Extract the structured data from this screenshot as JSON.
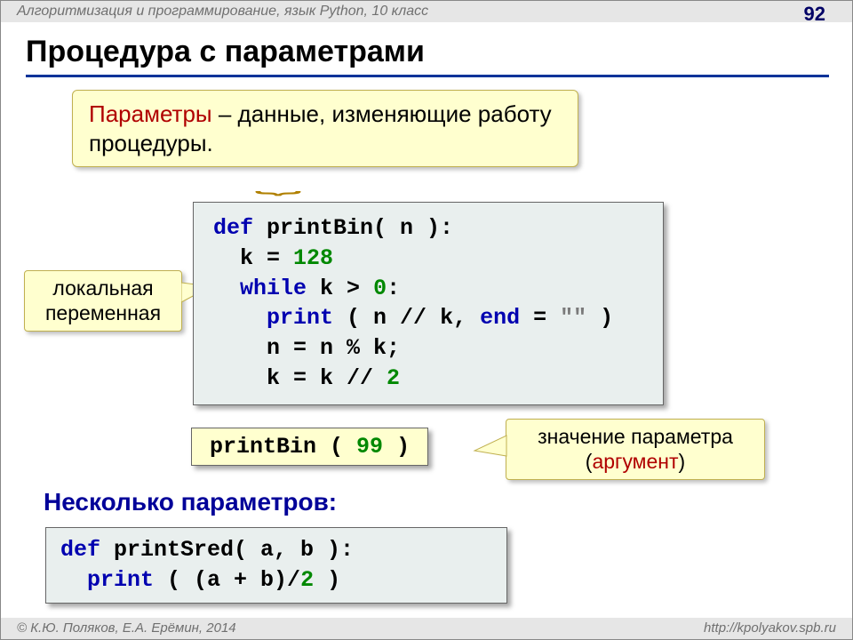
{
  "header": "Алгоритмизация и программирование, язык Python, 10 класс",
  "page": "92",
  "title": "Процедура с параметрами",
  "callout_params_pre": "Параметры",
  "callout_params_rest": " – данные, изменяющие работу процедуры.",
  "local_var_label": "локальная переменная",
  "code_main": {
    "l1a": "def ",
    "l1b": "printBin( n ):",
    "l2a": "  k",
    "l2b": " = ",
    "l2c": "128",
    "l3a": "  while ",
    "l3b": "k",
    ">": " > ",
    "l3c": "0",
    "l3d": ":",
    "l4a": "    print",
    "l4b": " ( n",
    "l4c": " // ",
    "l4d": "k, ",
    "l4e": "end",
    "l4f": " = ",
    "l4g": "\"\" ",
    "l4h": ")",
    "l5": "    n = n % k;",
    "l6a": "    k = k",
    "l6b": " // ",
    "l6c": "2"
  },
  "call_line_fn": "printBin ",
  "call_line_open": "( ",
  "call_line_num": "99",
  "call_line_close": " )",
  "arg_label_l1": "значение параметра",
  "arg_label_l2a": "(",
  "arg_label_l2b": "аргумент",
  "arg_label_l2c": ")",
  "subheading": "Несколько параметров:",
  "code2_l1a": "def ",
  "code2_l1b": "printSred( a, b ):",
  "code2_l2a": "  print",
  "code2_l2b": " ( (a + b)/",
  "code2_l2c": "2",
  "code2_l2d": " )",
  "footer_left": "© К.Ю. Поляков, Е.А. Ерёмин, 2014",
  "footer_right": "http://kpolyakov.spb.ru"
}
